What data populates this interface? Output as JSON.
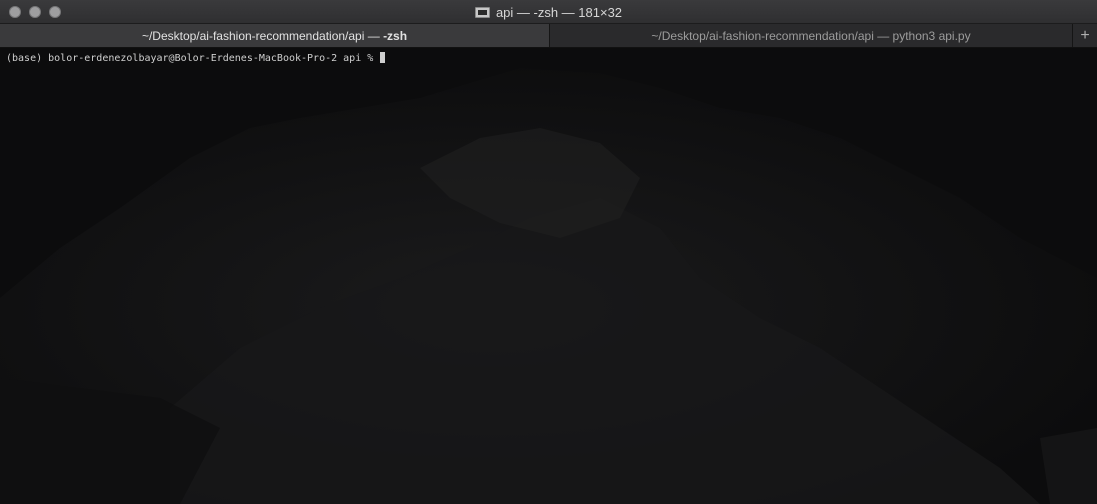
{
  "window": {
    "title": "api — -zsh — 181×32",
    "icon": "terminal-icon"
  },
  "tabs": [
    {
      "prefix": "~/Desktop/ai-fashion-recommendation/api — ",
      "command": "-zsh",
      "active": true
    },
    {
      "prefix": "~/Desktop/ai-fashion-recommendation/api — python3 api.py",
      "command": "",
      "active": false
    }
  ],
  "new_tab": {
    "label": "+",
    "icon": "plus-icon"
  },
  "terminal": {
    "prompt": "(base) bolor-erdenezolbayar@Bolor-Erdenes-MacBook-Pro-2 api % "
  },
  "colors": {
    "background": "#0d0d0e",
    "text": "#cfcfcf"
  }
}
